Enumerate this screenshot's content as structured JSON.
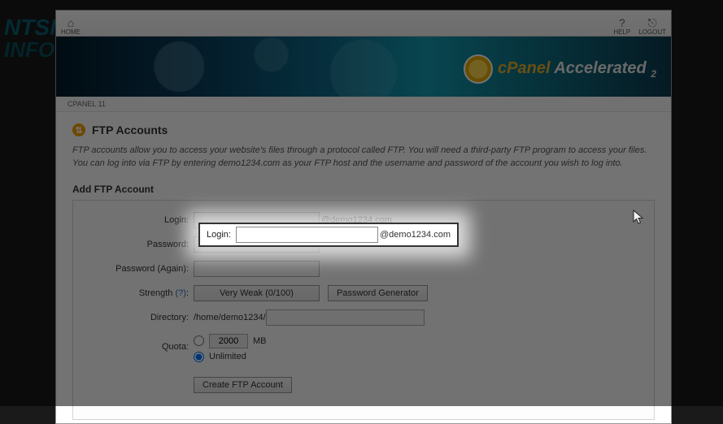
{
  "bg": {
    "line1": "NTSI",
    "line2": "INFORMATIQUE"
  },
  "topbar": {
    "home": "HOME",
    "help": "HELP",
    "logout": "LOGOUT"
  },
  "brand": {
    "cpanel": "cPanel",
    "accel": "Accelerated",
    "sub": "2"
  },
  "breadcrumb": "CPANEL 11",
  "page": {
    "title": "FTP Accounts",
    "intro": "FTP accounts allow you to access your website's files through a protocol called FTP. You will need a third-party FTP program to access your files. You can log into via FTP by entering demo1234.com as your FTP host and the username and password of the account you wish to log into.",
    "add_header": "Add FTP Account"
  },
  "form": {
    "login_label": "Login:",
    "login_value": "",
    "domain_suffix": "@demo1234.com",
    "password_label": "Password:",
    "password2_label": "Password (Again):",
    "strength_label_pre": "Strength ",
    "strength_help": "(?)",
    "strength_colon": ":",
    "strength_value": "Very Weak (0/100)",
    "pw_gen": "Password Generator",
    "directory_label": "Directory:",
    "directory_prefix": "/home/demo1234/",
    "directory_value": "",
    "quota_label": "Quota:",
    "quota_num": "2000",
    "quota_unit": "MB",
    "quota_unlimited": "Unlimited",
    "create_btn": "Create FTP Account"
  }
}
